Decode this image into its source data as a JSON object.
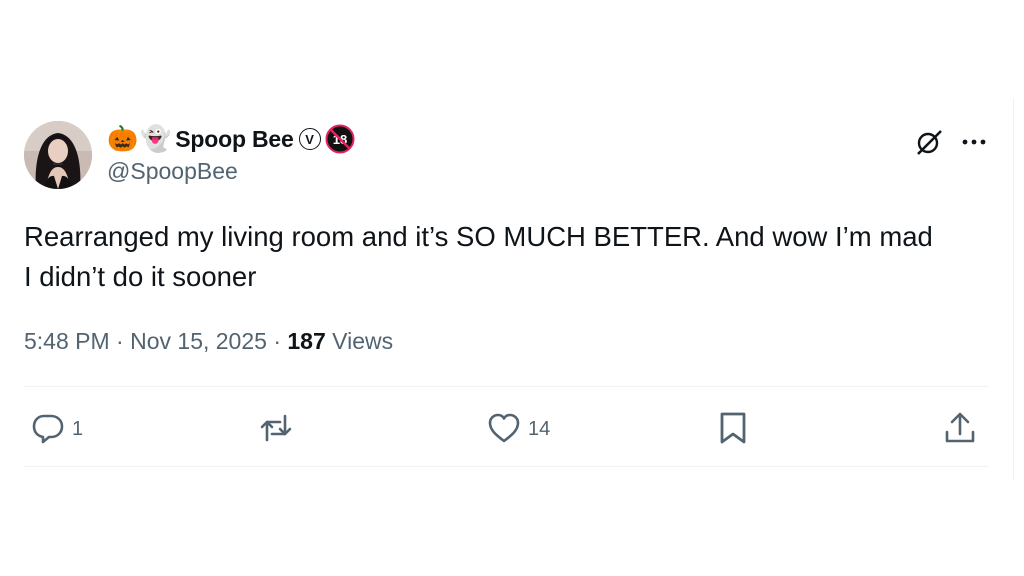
{
  "tweet": {
    "author": {
      "emojis": [
        "🎃",
        "👻"
      ],
      "display_name": "Spoop Bee",
      "handle": "@SpoopBee",
      "badges": [
        "Ⓥ",
        "18"
      ]
    },
    "text_line1": "Rearranged my living room and it’s SO MUCH BETTER. And wow I’m mad",
    "text_line2": "I didn’t do it sooner",
    "time": "5:48 PM",
    "separator": " · ",
    "date": "Nov 15, 2025",
    "views_count": "187",
    "views_label": " Views",
    "actions": {
      "reply_count": "1",
      "retweet_count": "",
      "like_count": "14"
    }
  },
  "icons": {
    "grok": "grok-icon",
    "more": "more-icon",
    "reply": "reply-icon",
    "retweet": "retweet-icon",
    "like": "heart-icon",
    "bookmark": "bookmark-icon",
    "share": "share-icon"
  },
  "colors": {
    "text": "#0f1419",
    "secondary": "#536471",
    "divider": "#eff3f4",
    "badge_red": "#e0245e"
  }
}
